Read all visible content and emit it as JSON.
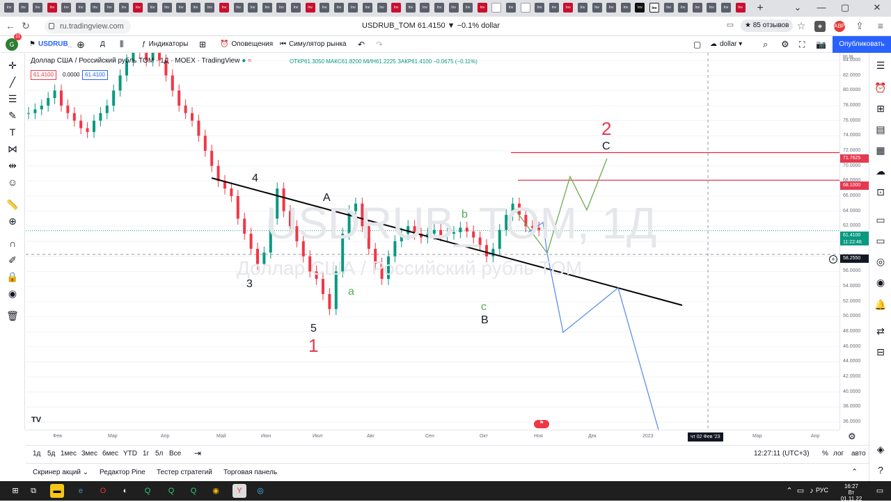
{
  "browser": {
    "tabs_count": 52,
    "page_title": "USDRUB_TOM 61.4150 ▼ −0.1% dollar",
    "url": "ru.tradingview.com",
    "reviews": "★ 85 отзывов",
    "ext_abp": "ABP",
    "profile_badge": "11"
  },
  "toolbar": {
    "symbol": "USDRUB_",
    "interval": "Д",
    "indicators": "Индикаторы",
    "alerts": "Оповещения",
    "replay": "Симулятор рынка",
    "currency_unit": "dollar",
    "publish": "Опубликовать"
  },
  "legend": {
    "title": "Доллар США / Российский рубль TOM · 1Д · MOEX · TradingView",
    "ohlc": "ОТКР61.3050 МАКС61.8200 МИН61.2225 ЗАКР61.4100 −0.0675 (−0.11%)",
    "bid": "61.4100",
    "spread": "0.0000",
    "ask": "61.4100"
  },
  "watermark": {
    "symbol": "USDRUB_TOM, 1Д",
    "desc": "Доллар США / Российский рубль TOM"
  },
  "chart_data": {
    "type": "candlestick",
    "currency_label": "RUB",
    "ylim": [
      35,
      85
    ],
    "y_ticks": [
      "84.0000",
      "82.0000",
      "80.0000",
      "78.0000",
      "76.0000",
      "74.0000",
      "72.0000",
      "70.0000",
      "68.0000",
      "66.0000",
      "64.0000",
      "62.0000",
      "60.0000",
      "58.0000",
      "56.0000",
      "54.0000",
      "52.0000",
      "50.0000",
      "48.0000",
      "46.0000",
      "44.0000",
      "42.0000",
      "40.0000",
      "38.0000",
      "36.0000"
    ],
    "x_ticks": [
      "Фев",
      "Мар",
      "Апр",
      "Май",
      "Июн",
      "Июл",
      "Авг",
      "Сен",
      "Окт",
      "Ноя",
      "Дек",
      "2023",
      "Мар",
      "Апр"
    ],
    "crosshair_date": "чт 02 Фев '23",
    "crosshair_price": "58.2550",
    "last_price": "61.4100",
    "countdown": "11:22:48",
    "horizontal_levels": [
      "71.7625",
      "68.1000"
    ],
    "wave_labels": {
      "w4": "4",
      "w3": "3",
      "w5": "5",
      "w1": "1",
      "wA": "A",
      "wa": "a",
      "wb": "b",
      "wc": "c",
      "wB": "B",
      "wC": "C",
      "w2": "2"
    },
    "series": [
      {
        "name": "price",
        "values": [
          77,
          77.5,
          78,
          79,
          80,
          78,
          77,
          76,
          75,
          74.5,
          76,
          77,
          78,
          80,
          82,
          84,
          86,
          85,
          84,
          86,
          84,
          82,
          80,
          78,
          77,
          76,
          74,
          72,
          70,
          68,
          67,
          66,
          63,
          61,
          59,
          57,
          58.5,
          63,
          67,
          64,
          62,
          60,
          58,
          56,
          55,
          53,
          51,
          56,
          61,
          64,
          65,
          62,
          59,
          57,
          55,
          58,
          60,
          61,
          62,
          61,
          60.5,
          61,
          61.5,
          60.8,
          61,
          61.2,
          61.8,
          61.3,
          60.5,
          59.5,
          58,
          59,
          61.5,
          63.5,
          65,
          63.5,
          62,
          61.8,
          61.5,
          61.4
        ]
      }
    ]
  },
  "time_axis": {
    "timezone": "12:27:11 (UTC+3)",
    "pct": "%",
    "log": "лог",
    "auto": "авто"
  },
  "ranges": [
    "1д",
    "5д",
    "1мес",
    "3мес",
    "6мес",
    "YTD",
    "1г",
    "5л",
    "Все"
  ],
  "bottom_tabs": [
    "Скринер акций",
    "Редактор Pine",
    "Тестер стратегий",
    "Торговая панель"
  ],
  "taskbar": {
    "lang": "РУС",
    "time": "16:27",
    "date": "Вт 01.11.22"
  },
  "colors": {
    "accent": "#2962ff",
    "up": "#089981",
    "down": "#f23645",
    "level": "#e0293a",
    "green_path": "#6aa84f",
    "blue_path": "#5b8def"
  }
}
